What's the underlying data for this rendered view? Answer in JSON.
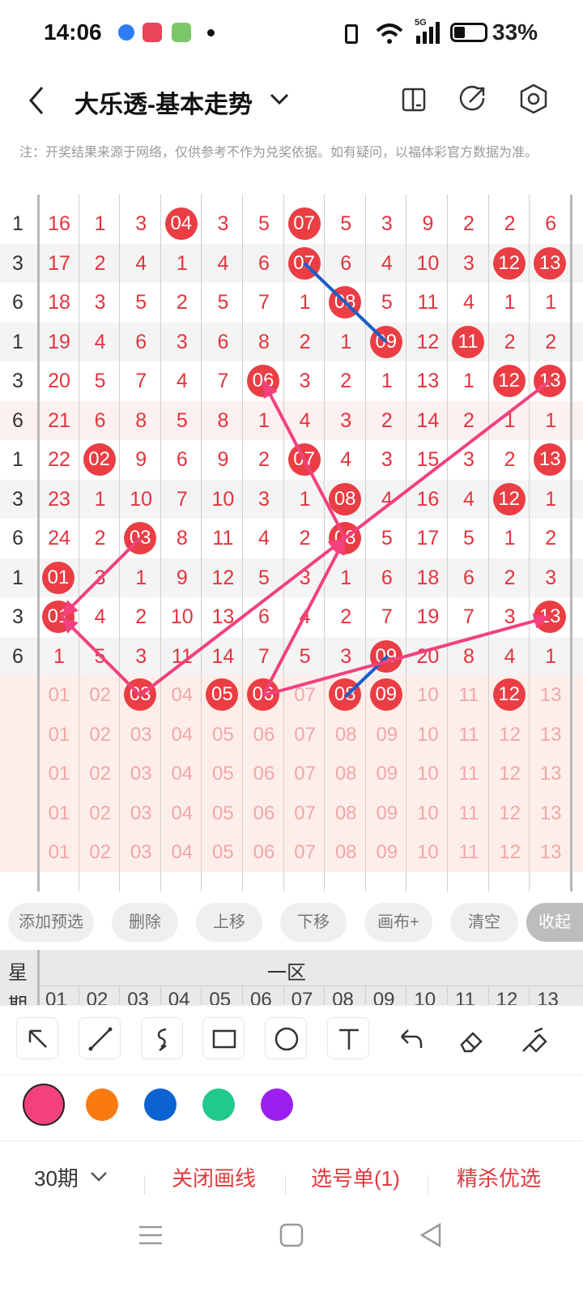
{
  "status": {
    "time": "14:06",
    "battery": "33%",
    "signal": "5G"
  },
  "header": {
    "title": "大乐透-基本走势"
  },
  "notice": "注：开奖结果来源于网络，仅供参考不作为兑奖依据。如有疑问，以福体彩官方数据为准。",
  "grid": {
    "rows": [
      {
        "p": "1",
        "c": [
          "16",
          "1",
          "3",
          "04",
          "3",
          "5",
          "07",
          "5",
          "3",
          "9",
          "2",
          "2",
          "6"
        ],
        "balls": [
          3,
          6
        ]
      },
      {
        "p": "3",
        "c": [
          "17",
          "2",
          "4",
          "1",
          "4",
          "6",
          "07",
          "6",
          "4",
          "10",
          "3",
          "12",
          "13"
        ],
        "balls": [
          6,
          11,
          12
        ]
      },
      {
        "p": "6",
        "c": [
          "18",
          "3",
          "5",
          "2",
          "5",
          "7",
          "1",
          "08",
          "5",
          "11",
          "4",
          "1",
          "1"
        ],
        "balls": [
          7
        ]
      },
      {
        "p": "1",
        "c": [
          "19",
          "4",
          "6",
          "3",
          "6",
          "8",
          "2",
          "1",
          "09",
          "12",
          "11",
          "2",
          "2"
        ],
        "balls": [
          8,
          10
        ]
      },
      {
        "p": "3",
        "c": [
          "20",
          "5",
          "7",
          "4",
          "7",
          "06",
          "3",
          "2",
          "1",
          "13",
          "1",
          "12",
          "13"
        ],
        "balls": [
          5,
          11,
          12
        ]
      },
      {
        "p": "6",
        "c": [
          "21",
          "6",
          "8",
          "5",
          "8",
          "1",
          "4",
          "3",
          "2",
          "14",
          "2",
          "1",
          "1"
        ],
        "balls": []
      },
      {
        "p": "1",
        "c": [
          "22",
          "02",
          "9",
          "6",
          "9",
          "2",
          "07",
          "4",
          "3",
          "15",
          "3",
          "2",
          "13"
        ],
        "balls": [
          1,
          6,
          12
        ]
      },
      {
        "p": "3",
        "c": [
          "23",
          "1",
          "10",
          "7",
          "10",
          "3",
          "1",
          "08",
          "4",
          "16",
          "4",
          "12",
          "1"
        ],
        "balls": [
          7,
          11
        ]
      },
      {
        "p": "6",
        "c": [
          "24",
          "2",
          "03",
          "8",
          "11",
          "4",
          "2",
          "08",
          "5",
          "17",
          "5",
          "1",
          "2"
        ],
        "balls": [
          2,
          7
        ]
      },
      {
        "p": "1",
        "c": [
          "01",
          "3",
          "1",
          "9",
          "12",
          "5",
          "3",
          "1",
          "6",
          "18",
          "6",
          "2",
          "3"
        ],
        "balls": [
          0
        ]
      },
      {
        "p": "3",
        "c": [
          "01",
          "4",
          "2",
          "10",
          "13",
          "6",
          "4",
          "2",
          "7",
          "19",
          "7",
          "3",
          "13"
        ],
        "balls": [
          0,
          12
        ]
      },
      {
        "p": "6",
        "c": [
          "1",
          "5",
          "3",
          "11",
          "14",
          "7",
          "5",
          "3",
          "09",
          "20",
          "8",
          "4",
          "1"
        ],
        "balls": [
          8
        ]
      }
    ],
    "pick_numbers": [
      "01",
      "02",
      "03",
      "04",
      "05",
      "06",
      "07",
      "08",
      "09",
      "10",
      "11",
      "12",
      "13"
    ],
    "selected_row_balls": [
      2,
      4,
      5,
      7,
      8,
      11
    ]
  },
  "actions": [
    "添加预选",
    "删除",
    "上移",
    "下移",
    "画布+",
    "清空",
    "收起"
  ],
  "zone": {
    "weekday_label_1": "星",
    "weekday_label_2": "期",
    "zone_label": "一区"
  },
  "colors": [
    "#f2417e",
    "#f97a0f",
    "#0b63d2",
    "#22c98c",
    "#9d1ff0"
  ],
  "bottom": {
    "periods": "30期",
    "close_draw": "关闭画线",
    "pick_list": "选号单(1)",
    "best_pick": "精杀优选"
  }
}
